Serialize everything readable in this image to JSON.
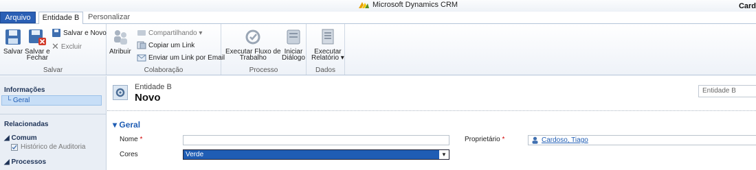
{
  "titlebar": {
    "app_title": "Microsoft Dynamics CRM",
    "user_name": "Card"
  },
  "ribbon_tabs": {
    "file": "Arquivo",
    "active": "Entidade B",
    "other": "Personalizar"
  },
  "ribbon": {
    "salvar_group": {
      "label": "Salvar",
      "save": "Salvar",
      "save_close_line1": "Salvar e",
      "save_close_line2": "Fechar",
      "save_new": "Salvar e Novo",
      "delete": "Excluir"
    },
    "colab_group": {
      "label": "Colaboração",
      "assign": "Atribuir",
      "share": "Compartilhando ▾",
      "copy_link": "Copiar um Link",
      "email_link": "Enviar um Link por Email"
    },
    "process_group": {
      "label": "Processo",
      "run_workflow_line1": "Executar Fluxo de",
      "run_workflow_line2": "Trabalho",
      "start_dialog_line1": "Iniciar",
      "start_dialog_line2": "Diálogo"
    },
    "data_group": {
      "label": "Dados",
      "run_report_line1": "Executar",
      "run_report_line2": "Relatório ▾"
    }
  },
  "nav": {
    "info_header": "Informações",
    "geral": "Geral",
    "related_header": "Relacionadas",
    "comum_header": "◢ Comum",
    "audit_history": "Histórico de Auditoria",
    "processes_header": "◢ Processos"
  },
  "form": {
    "entity_type": "Entidade B",
    "record_title": "Novo",
    "entity_select": "Entidade B",
    "section_title": "▾ Geral",
    "nome_label": "Nome",
    "nome_value": "",
    "cores_label": "Cores",
    "cores_value": "Verde",
    "owner_label": "Proprietário",
    "owner_value": "Cardoso, Tiago",
    "required_mark": "*"
  },
  "colors": {
    "accent": "#1f5db4",
    "file_tab": "#2a5fb5",
    "required": "#d00000"
  }
}
